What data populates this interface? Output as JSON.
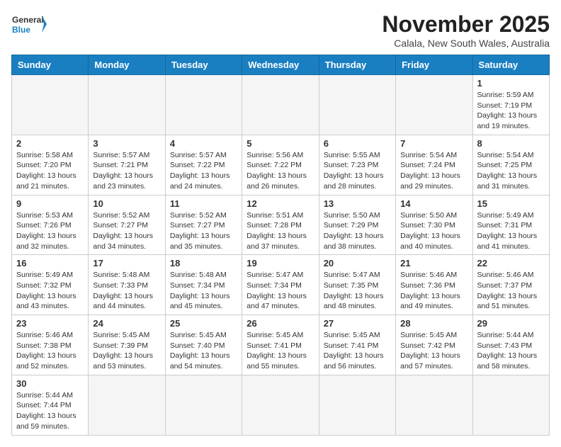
{
  "logo": {
    "text_general": "General",
    "text_blue": "Blue"
  },
  "title": "November 2025",
  "location": "Calala, New South Wales, Australia",
  "weekdays": [
    "Sunday",
    "Monday",
    "Tuesday",
    "Wednesday",
    "Thursday",
    "Friday",
    "Saturday"
  ],
  "weeks": [
    [
      {
        "day": "",
        "info": ""
      },
      {
        "day": "",
        "info": ""
      },
      {
        "day": "",
        "info": ""
      },
      {
        "day": "",
        "info": ""
      },
      {
        "day": "",
        "info": ""
      },
      {
        "day": "",
        "info": ""
      },
      {
        "day": "1",
        "info": "Sunrise: 5:59 AM\nSunset: 7:19 PM\nDaylight: 13 hours and 19 minutes."
      }
    ],
    [
      {
        "day": "2",
        "info": "Sunrise: 5:58 AM\nSunset: 7:20 PM\nDaylight: 13 hours and 21 minutes."
      },
      {
        "day": "3",
        "info": "Sunrise: 5:57 AM\nSunset: 7:21 PM\nDaylight: 13 hours and 23 minutes."
      },
      {
        "day": "4",
        "info": "Sunrise: 5:57 AM\nSunset: 7:22 PM\nDaylight: 13 hours and 24 minutes."
      },
      {
        "day": "5",
        "info": "Sunrise: 5:56 AM\nSunset: 7:22 PM\nDaylight: 13 hours and 26 minutes."
      },
      {
        "day": "6",
        "info": "Sunrise: 5:55 AM\nSunset: 7:23 PM\nDaylight: 13 hours and 28 minutes."
      },
      {
        "day": "7",
        "info": "Sunrise: 5:54 AM\nSunset: 7:24 PM\nDaylight: 13 hours and 29 minutes."
      },
      {
        "day": "8",
        "info": "Sunrise: 5:54 AM\nSunset: 7:25 PM\nDaylight: 13 hours and 31 minutes."
      }
    ],
    [
      {
        "day": "9",
        "info": "Sunrise: 5:53 AM\nSunset: 7:26 PM\nDaylight: 13 hours and 32 minutes."
      },
      {
        "day": "10",
        "info": "Sunrise: 5:52 AM\nSunset: 7:27 PM\nDaylight: 13 hours and 34 minutes."
      },
      {
        "day": "11",
        "info": "Sunrise: 5:52 AM\nSunset: 7:27 PM\nDaylight: 13 hours and 35 minutes."
      },
      {
        "day": "12",
        "info": "Sunrise: 5:51 AM\nSunset: 7:28 PM\nDaylight: 13 hours and 37 minutes."
      },
      {
        "day": "13",
        "info": "Sunrise: 5:50 AM\nSunset: 7:29 PM\nDaylight: 13 hours and 38 minutes."
      },
      {
        "day": "14",
        "info": "Sunrise: 5:50 AM\nSunset: 7:30 PM\nDaylight: 13 hours and 40 minutes."
      },
      {
        "day": "15",
        "info": "Sunrise: 5:49 AM\nSunset: 7:31 PM\nDaylight: 13 hours and 41 minutes."
      }
    ],
    [
      {
        "day": "16",
        "info": "Sunrise: 5:49 AM\nSunset: 7:32 PM\nDaylight: 13 hours and 43 minutes."
      },
      {
        "day": "17",
        "info": "Sunrise: 5:48 AM\nSunset: 7:33 PM\nDaylight: 13 hours and 44 minutes."
      },
      {
        "day": "18",
        "info": "Sunrise: 5:48 AM\nSunset: 7:34 PM\nDaylight: 13 hours and 45 minutes."
      },
      {
        "day": "19",
        "info": "Sunrise: 5:47 AM\nSunset: 7:34 PM\nDaylight: 13 hours and 47 minutes."
      },
      {
        "day": "20",
        "info": "Sunrise: 5:47 AM\nSunset: 7:35 PM\nDaylight: 13 hours and 48 minutes."
      },
      {
        "day": "21",
        "info": "Sunrise: 5:46 AM\nSunset: 7:36 PM\nDaylight: 13 hours and 49 minutes."
      },
      {
        "day": "22",
        "info": "Sunrise: 5:46 AM\nSunset: 7:37 PM\nDaylight: 13 hours and 51 minutes."
      }
    ],
    [
      {
        "day": "23",
        "info": "Sunrise: 5:46 AM\nSunset: 7:38 PM\nDaylight: 13 hours and 52 minutes."
      },
      {
        "day": "24",
        "info": "Sunrise: 5:45 AM\nSunset: 7:39 PM\nDaylight: 13 hours and 53 minutes."
      },
      {
        "day": "25",
        "info": "Sunrise: 5:45 AM\nSunset: 7:40 PM\nDaylight: 13 hours and 54 minutes."
      },
      {
        "day": "26",
        "info": "Sunrise: 5:45 AM\nSunset: 7:41 PM\nDaylight: 13 hours and 55 minutes."
      },
      {
        "day": "27",
        "info": "Sunrise: 5:45 AM\nSunset: 7:41 PM\nDaylight: 13 hours and 56 minutes."
      },
      {
        "day": "28",
        "info": "Sunrise: 5:45 AM\nSunset: 7:42 PM\nDaylight: 13 hours and 57 minutes."
      },
      {
        "day": "29",
        "info": "Sunrise: 5:44 AM\nSunset: 7:43 PM\nDaylight: 13 hours and 58 minutes."
      }
    ],
    [
      {
        "day": "30",
        "info": "Sunrise: 5:44 AM\nSunset: 7:44 PM\nDaylight: 13 hours and 59 minutes."
      },
      {
        "day": "",
        "info": ""
      },
      {
        "day": "",
        "info": ""
      },
      {
        "day": "",
        "info": ""
      },
      {
        "day": "",
        "info": ""
      },
      {
        "day": "",
        "info": ""
      },
      {
        "day": "",
        "info": ""
      }
    ]
  ]
}
